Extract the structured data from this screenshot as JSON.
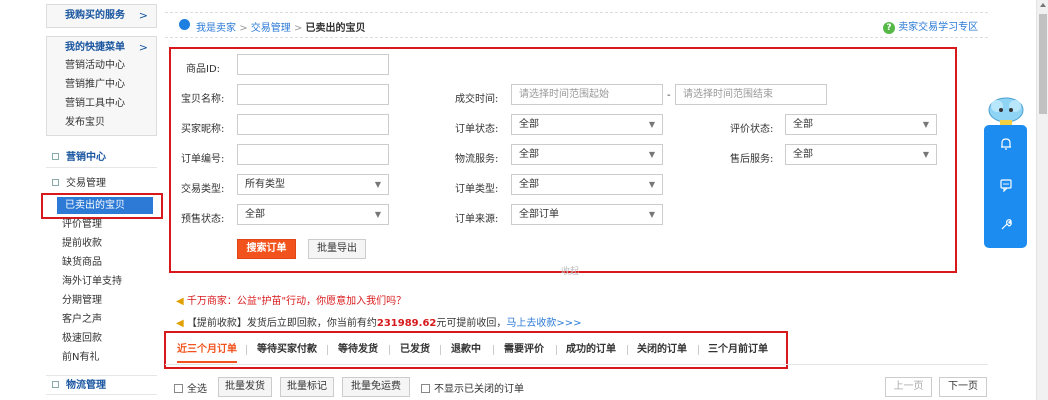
{
  "sidebar": {
    "my_services": "我购买的服务",
    "my_services_arrow": ">",
    "shortcut_title": "我的快捷菜单",
    "shortcut_arrow": ">",
    "shortcut_items": [
      "营销活动中心",
      "营销推广中心",
      "营销工具中心",
      "发布宝贝"
    ],
    "marketing_center": "营销中心",
    "trade_manage": "交易管理",
    "trade_items": [
      "已卖出的宝贝",
      "评价管理",
      "提前收款",
      "缺货商品",
      "海外订单支持",
      "分期管理",
      "客户之声",
      "极速回款",
      "前N有礼"
    ],
    "logistics_manage": "物流管理"
  },
  "breadcrumb": {
    "items": [
      "我是卖家",
      "交易管理",
      "已卖出的宝贝"
    ],
    "sep": ">",
    "help_link": "卖家交易学习专区"
  },
  "search": {
    "product_id_label": "商品ID:",
    "item_name_label": "宝贝名称:",
    "buyer_nick_label": "买家昵称:",
    "order_no_label": "订单编号:",
    "trade_type_label": "交易类型:",
    "trade_type_value": "所有类型",
    "presale_label": "预售状态:",
    "presale_value": "全部",
    "deal_time_label": "成交时间:",
    "time_start_placeholder": "请选择时间范围起始",
    "time_dash": "-",
    "time_end_placeholder": "请选择时间范围结束",
    "order_status_label": "订单状态:",
    "order_status_value": "全部",
    "logistics_label": "物流服务:",
    "logistics_value": "全部",
    "order_type_label": "订单类型:",
    "order_type_value": "全部",
    "order_source_label": "订单来源:",
    "order_source_value": "全部订单",
    "rating_label": "评价状态:",
    "rating_value": "全部",
    "aftersale_label": "售后服务:",
    "aftersale_value": "全部",
    "search_button": "搜索订单",
    "export_button": "批量导出",
    "collapse": "收起"
  },
  "notices": {
    "notice1": "千万商家：公益\"护苗\"行动，你愿意加入我们吗？",
    "notice2_prefix": "【提前收款】发货后立即回款，你当前有约",
    "notice2_amount": "231989.62",
    "notice2_suffix": "元可提前收回，",
    "notice2_link": "马上去收款>>>"
  },
  "tabs": [
    "近三个月订单",
    "等待买家付款",
    "等待发货",
    "已发货",
    "退款中",
    "需要评价",
    "成功的订单",
    "关闭的订单",
    "三个月前订单"
  ],
  "toolbar": {
    "select_all": "全选",
    "batch_ship": "批量发货",
    "batch_mark": "批量标记",
    "batch_free_ship": "批量免运费",
    "hide_closed": "不显示已关闭的订单",
    "prev_page": "上一页",
    "next_page": "下一页"
  },
  "colors": {
    "accent": "#2c7ad6",
    "highlight_red": "#d8191b",
    "search_btn": "#f2521b",
    "float_bar": "#1d8cf0"
  }
}
